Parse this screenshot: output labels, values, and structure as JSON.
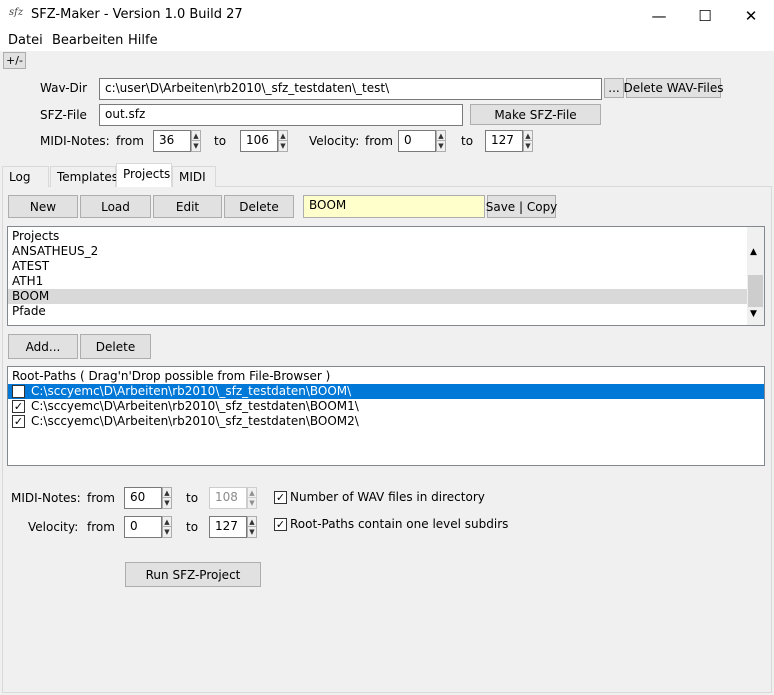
{
  "window": {
    "icon_text": "sfz",
    "title": "SFZ-Maker - Version 1.0 Build 27",
    "minimize": "—",
    "maximize": "☐",
    "close": "✕"
  },
  "menu": [
    {
      "label": "Datei"
    },
    {
      "label": "Bearbeiten"
    },
    {
      "label": "Hilfe"
    }
  ],
  "toggle_button": "+/-",
  "wavdir": {
    "label": "Wav-Dir",
    "value": "c:\\user\\D\\Arbeiten\\rb2010\\_sfz_testdaten\\_test\\",
    "browse": "...",
    "delete": "Delete WAV-Files"
  },
  "sfzfile": {
    "label": "SFZ-File",
    "value": "out.sfz",
    "make": "Make SFZ-File"
  },
  "top_ranges": {
    "midi_label": "MIDI-Notes:",
    "from": "from",
    "midi_from": "36",
    "to": "to",
    "midi_to": "106",
    "velocity_label": "Velocity:",
    "vel_from": "0",
    "vel_to": "127"
  },
  "tabs": [
    {
      "label": "Log"
    },
    {
      "label": "Templates"
    },
    {
      "label": "Projects"
    },
    {
      "label": "MIDI"
    }
  ],
  "project_toolbar": {
    "new": "New",
    "load": "Load",
    "edit": "Edit",
    "delete": "Delete",
    "name_value": "BOOM",
    "save": "Save | Copy"
  },
  "projects": {
    "header": "Projects",
    "items": [
      "ANSATHEUS_2",
      "ATEST",
      "ATH1",
      "BOOM",
      "Pfade"
    ],
    "selected": "BOOM"
  },
  "path_buttons": {
    "add": "Add...",
    "delete": "Delete"
  },
  "root_paths": {
    "header": "Root-Paths ( Drag'n'Drop possible from File-Browser )",
    "items": [
      "C:\\sccyemc\\D\\Arbeiten\\rb2010\\_sfz_testdaten\\BOOM\\",
      "C:\\sccyemc\\D\\Arbeiten\\rb2010\\_sfz_testdaten\\BOOM1\\",
      "C:\\sccyemc\\D\\Arbeiten\\rb2010\\_sfz_testdaten\\BOOM2\\"
    ]
  },
  "bottom_ranges": {
    "midi_label": "MIDI-Notes:",
    "from": "from",
    "midi_from": "60",
    "to": "to",
    "midi_to": "108",
    "velocity_label": "Velocity:",
    "vel_from": "0",
    "vel_to": "127",
    "opt_wav_count": "Number of WAV files in directory",
    "opt_subdirs": "Root-Paths contain one level subdirs"
  },
  "run_button": "Run SFZ-Project",
  "colors": {
    "selection": "#0078d7",
    "list_highlight": "#d9d9d9",
    "name_field_bg": "#ffffcc"
  }
}
